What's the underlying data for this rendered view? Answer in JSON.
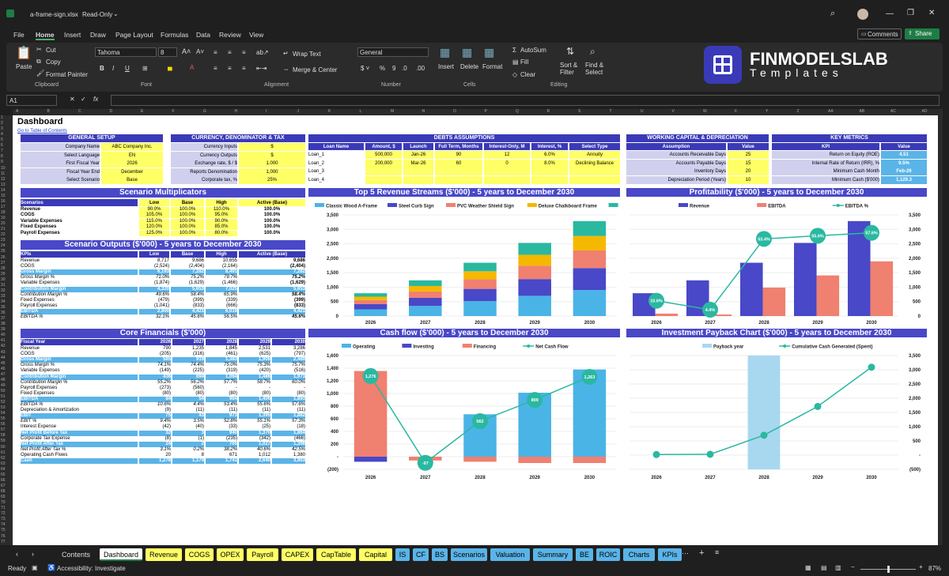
{
  "window": {
    "filename": "a-frame-sign.xlsx",
    "mode": "Read-Only"
  },
  "menu": [
    "File",
    "Home",
    "Insert",
    "Draw",
    "Page Layout",
    "Formulas",
    "Data",
    "Review",
    "View"
  ],
  "comments_label": "Comments",
  "share_label": "Share",
  "ribbon": {
    "paste": "Paste",
    "cut": "Cut",
    "copy": "Copy",
    "format_painter": "Format Painter",
    "clipboard": "Clipboard",
    "font_name": "Tahoma",
    "font_size": "8",
    "font": "Font",
    "wrap_text": "Wrap Text",
    "merge_center": "Merge & Center",
    "alignment": "Alignment",
    "number_format": "General",
    "number": "Number",
    "insert": "Insert",
    "delete": "Delete",
    "format": "Format",
    "cells": "Cells",
    "autosum": "AutoSum",
    "fill": "Fill",
    "clear": "Clear",
    "sort_filter": "Sort & Filter",
    "find_select": "Find & Select",
    "editing": "Editing"
  },
  "brand": {
    "name": "FINMODELSLAB",
    "sub": "Templates"
  },
  "name_box": "A1",
  "columns": [
    "A",
    "B",
    "C",
    "D",
    "E",
    "F",
    "G",
    "H",
    "I",
    "J",
    "K",
    "L",
    "M",
    "N",
    "O",
    "P",
    "Q",
    "R",
    "S",
    "T",
    "U",
    "V",
    "W",
    "X",
    "Y",
    "Z",
    "AA",
    "AB",
    "AC",
    "AD"
  ],
  "sheet": {
    "title": "Dashboard",
    "toc_link": "Go to Table of Contents"
  },
  "general_setup": {
    "title": "GENERAL SETUP",
    "rows": [
      [
        "Company Name",
        "ABC Company Inc."
      ],
      [
        "Select Language",
        "EN"
      ],
      [
        "First Fiscal Year",
        "2026"
      ],
      [
        "Fiscal Year End",
        "December"
      ],
      [
        "Select Scenario",
        "Base"
      ]
    ]
  },
  "currency": {
    "title": "CURRENCY, DENOMINATOR & TAX",
    "rows": [
      [
        "Currency Inputs",
        "$"
      ],
      [
        "Currency Outputs",
        "$"
      ],
      [
        "Exchange rate, $ / $",
        "1.000"
      ],
      [
        "Reports Denomination",
        "1,000"
      ],
      [
        "Corporate tax, %",
        "25%"
      ]
    ]
  },
  "debts": {
    "title": "DEBTS ASSUMPTIONS",
    "headers": [
      "Loan Name",
      "Amount, $",
      "Launch",
      "Full Term, Months",
      "Interest-Only, M",
      "Interest, %",
      "Select Type"
    ],
    "rows": [
      [
        "Loan_1",
        "500,000",
        "Jan-26",
        "90",
        "12",
        "6.0%",
        "Annuity"
      ],
      [
        "Loan_2",
        "200,000",
        "Mar-26",
        "60",
        "0",
        "8.0%",
        "Declining Balance"
      ],
      [
        "Loan_3",
        "",
        "",
        "",
        "",
        "",
        ""
      ],
      [
        "Loan_4",
        "",
        "",
        "",
        "",
        "",
        ""
      ]
    ]
  },
  "working_capital": {
    "title": "WORKING CAPITAL & DEPRECIATION",
    "headers": [
      "Assumption",
      "Value"
    ],
    "rows": [
      [
        "Accounts Receivable Days",
        "25"
      ],
      [
        "Accounts Payable Days",
        "15"
      ],
      [
        "Inventory Days",
        "20"
      ],
      [
        "Depreciation Period (Years)",
        "10"
      ]
    ]
  },
  "kpis": {
    "title": "KEY METRICS",
    "headers": [
      "KPI",
      "Value"
    ],
    "rows": [
      [
        "Return on Equity (ROE)",
        "4.51"
      ],
      [
        "Internal Rate of Return (IRR), %",
        "9.5%"
      ],
      [
        "Minimum Cash Month",
        "Feb-26"
      ],
      [
        "Minimum Cash ($'000)",
        "1,129.3"
      ]
    ]
  },
  "scenario_mult": {
    "title": "Scenario Multiplicators",
    "headers": [
      "Scenarios",
      "Low",
      "Base",
      "High",
      "Active (Base)"
    ],
    "rows": [
      [
        "Revenue",
        "90.0%",
        "100.0%",
        "110.0%",
        "100.0%"
      ],
      [
        "COGS",
        "105.0%",
        "100.0%",
        "95.0%",
        "100.0%"
      ],
      [
        "Variable Expenses",
        "115.0%",
        "100.0%",
        "90.0%",
        "100.0%"
      ],
      [
        "Fixed Expenses",
        "120.0%",
        "100.0%",
        "85.0%",
        "100.0%"
      ],
      [
        "Payroll Expenses",
        "125.0%",
        "100.0%",
        "80.0%",
        "100.0%"
      ]
    ]
  },
  "scenario_out": {
    "title": "Scenario Outputs ($'000) - 5 years to December 2030",
    "headers": [
      "KPIs",
      "Low",
      "Base",
      "High",
      "Active (Base)"
    ],
    "rows": [
      [
        "Revenue",
        "8,717",
        "9,686",
        "10,655",
        "9,686"
      ],
      [
        "COGS",
        "(2,524)",
        "(2,404)",
        "(2,164)",
        "(2,404)"
      ],
      [
        "Gross Margin",
        "6,193",
        "7,282",
        "8,491",
        "7,282"
      ],
      [
        "Gross Margin %",
        "71.0%",
        "75.2%",
        "79.7%",
        "75.2%"
      ],
      [
        "Variable Expenses",
        "(1,874)",
        "(1,629)",
        "(1,466)",
        "(1,629)"
      ],
      [
        "Contribution Margin",
        "4,320",
        "5,653",
        "7,025",
        "5,653"
      ],
      [
        "Contribution Margin %",
        "49.6%",
        "58.4%",
        "65.9%",
        "58.4%"
      ],
      [
        "Fixed Expenses",
        "(479)",
        "(399)",
        "(339)",
        "(399)"
      ],
      [
        "Payroll Expenses",
        "(1,041)",
        "(833)",
        "(666)",
        "(833)"
      ],
      [
        "EBITDA",
        "2,800",
        "4,421",
        "6,019",
        "4,421"
      ],
      [
        "EBITDA %",
        "32.1%",
        "45.6%",
        "56.5%",
        "45.6%"
      ]
    ]
  },
  "core": {
    "title": "Core Financials ($'000)",
    "headers": [
      "Fiscal Year",
      "2026",
      "2027",
      "2028",
      "2029",
      "2030"
    ],
    "rows": [
      [
        "Revenue",
        "790",
        "1,235",
        "1,845",
        "2,531",
        "3,286"
      ],
      [
        "COGS",
        "(205)",
        "(316)",
        "(461)",
        "(625)",
        "(797)"
      ],
      [
        "Gross Margin",
        "585",
        "919",
        "1,383",
        "1,906",
        "2,489"
      ],
      [
        "Gross Margin %",
        "74.1%",
        "74.4%",
        "75.0%",
        "75.3%",
        "75.7%"
      ],
      [
        "Variable Expenses",
        "(149)",
        "(225)",
        "(319)",
        "(420)",
        "(516)"
      ],
      [
        "Contribution Margin",
        "436",
        "694",
        "1,064",
        "1,486",
        "1,973"
      ],
      [
        "Contribution Margin %",
        "55.2%",
        "56.2%",
        "57.7%",
        "58.7%",
        "60.0%"
      ],
      [
        "Payroll Expenses",
        "(273)",
        "(560)",
        "-",
        "-",
        "-"
      ],
      [
        "Fixed Expenses",
        "(80)",
        "(80)",
        "(80)",
        "(80)",
        "(80)"
      ],
      [
        "EBITDA",
        "84",
        "54",
        "984",
        "1,406",
        "1,893"
      ],
      [
        "EBITDA %",
        "10.6%",
        "4.4%",
        "53.4%",
        "55.6%",
        "57.6%"
      ],
      [
        "Depreciation & Amortization",
        "(9)",
        "(11)",
        "(11)",
        "(11)",
        "(11)"
      ],
      [
        "EBIT",
        "75",
        "43",
        "973",
        "1,395",
        "1,882"
      ],
      [
        "EBIT %",
        "9.4%",
        "3.5%",
        "52.8%",
        "55.1%",
        "57.3%"
      ],
      [
        "Interest Expense",
        "(42)",
        "(40)",
        "(33)",
        "(25)",
        "(18)"
      ],
      [
        "Net Profit Before Tax",
        "32",
        "3",
        "940",
        "1,370",
        "1,864"
      ],
      [
        "Corporate Tax Expense",
        "(8)",
        "(1)",
        "(235)",
        "(342)",
        "(466)"
      ],
      [
        "Net Profit After Tax",
        "24",
        "2",
        "705",
        "1,027",
        "1,398"
      ],
      [
        "Net Profit After Tax %",
        "3.1%",
        "0.2%",
        "38.2%",
        "40.6%",
        "42.5%"
      ],
      [
        "Operating Cash Flows",
        "20",
        "8",
        "671",
        "1,012",
        "1,380"
      ],
      [
        "Cash",
        "1,276",
        "1,179",
        "1,741",
        "2,640",
        "3,903"
      ]
    ]
  },
  "charts": {
    "revenue": {
      "title": "Top 5 Revenue Streams ($'000) - 5 years to December 2030",
      "legend": [
        "Classic Wood A-Frame",
        "Steel Curb Sign",
        "PVC Weather Shield Sign",
        "Deluxe Chalkboard Frame",
        "Other Revenue"
      ],
      "colors": [
        "#4ab4e6",
        "#4848c8",
        "#f08070",
        "#f5b800",
        "#2ab8a0"
      ],
      "years": [
        "2026",
        "2027",
        "2028",
        "2029",
        "2030"
      ],
      "series": [
        [
          230,
          350,
          520,
          700,
          900
        ],
        [
          180,
          280,
          420,
          580,
          760
        ],
        [
          140,
          220,
          330,
          460,
          610
        ],
        [
          120,
          190,
          280,
          380,
          500
        ],
        [
          120,
          195,
          295,
          411,
          516
        ]
      ],
      "yticks": [
        "0",
        "500",
        "1,000",
        "1,500",
        "2,000",
        "2,500",
        "3,000",
        "3,500"
      ],
      "ymax": 3500
    },
    "profit": {
      "title": "Profitability ($'000) - 5 years to December 2030",
      "legend": [
        "Revenue",
        "EBITDA",
        "EBITDA %"
      ],
      "years": [
        "2026",
        "2027",
        "2028",
        "2029",
        "2030"
      ],
      "revenue": [
        790,
        1235,
        1845,
        2531,
        3286
      ],
      "ebitda": [
        84,
        54,
        984,
        1406,
        1893
      ],
      "pct": [
        10.6,
        4.4,
        53.4,
        55.6,
        57.6
      ],
      "pct_labels": [
        "10.6%",
        "4.4%",
        "53.4%",
        "55.6%",
        "57.6%"
      ],
      "yticks": [
        "0",
        "500",
        "1,000",
        "1,500",
        "2,000",
        "2,500",
        "3,000",
        "3,500"
      ],
      "ymax": 3500
    },
    "cashflow": {
      "title": "Cash flow ($'000) - 5 years to December 2030",
      "legend": [
        "Operating",
        "Investing",
        "Financing",
        "Net Cash Flow"
      ],
      "years": [
        "2026",
        "2027",
        "2028",
        "2029",
        "2030"
      ],
      "operating": [
        0,
        0,
        671,
        1012,
        1380
      ],
      "investing": [
        -80,
        0,
        0,
        0,
        0
      ],
      "financing": [
        1356,
        -60,
        -80,
        -100,
        -100
      ],
      "net": [
        1276,
        -97,
        562,
        899,
        1263
      ],
      "net_labels": [
        "1,276",
        "-97",
        "562",
        "899",
        "1,263"
      ],
      "yticks": [
        "(200)",
        "-",
        "200",
        "400",
        "600",
        "800",
        "1,000",
        "1,200",
        "1,400",
        "1,600"
      ],
      "ymin": -200,
      "ymax": 1600
    },
    "payback": {
      "title": "Investment Payback Chart ($'000) - 5 years to December 2030",
      "legend": [
        "Payback year",
        "Cumulative Cash Generated (Spent)"
      ],
      "years": [
        "2026",
        "2027",
        "2028",
        "2029",
        "2030"
      ],
      "cum": [
        20,
        28,
        699,
        1711,
        3091
      ],
      "payback_index": 2,
      "yticks": [
        "(500)",
        "-",
        "500",
        "1,000",
        "1,500",
        "2,000",
        "2,500",
        "3,000",
        "3,500"
      ],
      "ymin": -500,
      "ymax": 3500
    }
  },
  "tabs": [
    {
      "l": "Contents",
      "c": "none"
    },
    {
      "l": "Dashboard",
      "c": "active"
    },
    {
      "l": "Revenue",
      "c": "#ffff66"
    },
    {
      "l": "COGS",
      "c": "#ffff66"
    },
    {
      "l": "OPEX",
      "c": "#ffff66"
    },
    {
      "l": "Payroll",
      "c": "#ffff66"
    },
    {
      "l": "CAPEX",
      "c": "#ffff66"
    },
    {
      "l": "CapTable",
      "c": "#ffff66"
    },
    {
      "l": "Capital",
      "c": "#ffff66"
    },
    {
      "l": "IS",
      "c": "#5ab4e8"
    },
    {
      "l": "CF",
      "c": "#5ab4e8"
    },
    {
      "l": "BS",
      "c": "#5ab4e8"
    },
    {
      "l": "Scenarios",
      "c": "#5ab4e8"
    },
    {
      "l": "Valuation",
      "c": "#5ab4e8"
    },
    {
      "l": "Summary",
      "c": "#5ab4e8"
    },
    {
      "l": "BE",
      "c": "#5ab4e8"
    },
    {
      "l": "ROIC",
      "c": "#5ab4e8"
    },
    {
      "l": "Charts",
      "c": "#5ab4e8"
    },
    {
      "l": "KPIs",
      "c": "#5ab4e8"
    }
  ],
  "status": {
    "ready": "Ready",
    "accessibility": "Accessibility: Investigate",
    "zoom": "87%"
  }
}
